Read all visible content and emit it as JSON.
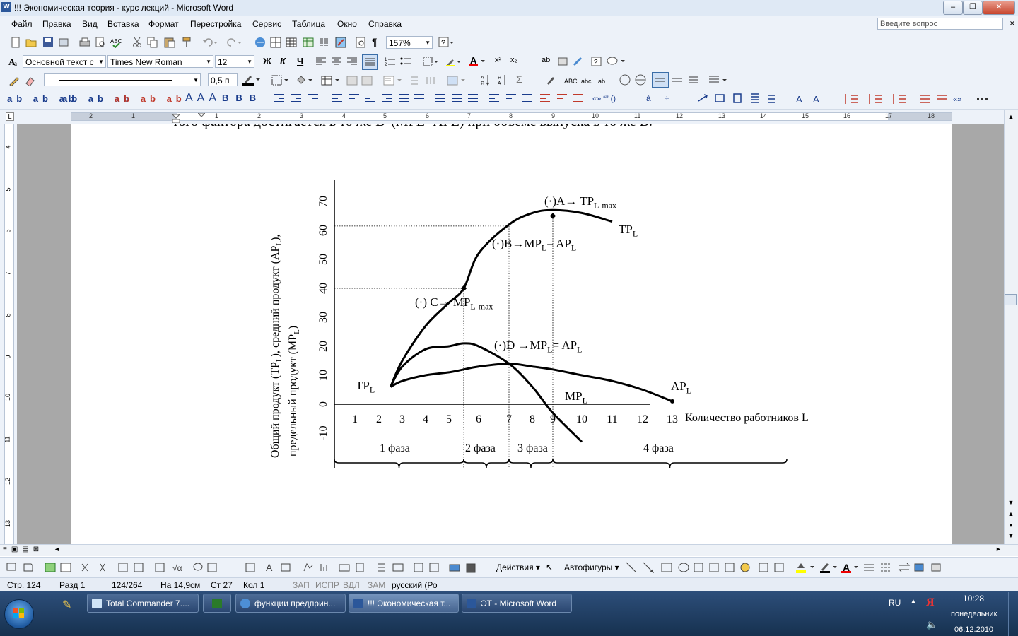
{
  "window": {
    "title": "!!! Экономическая теория - курс лекций - Microsoft Word",
    "app_icon": "W"
  },
  "menu": {
    "items": [
      "Файл",
      "Правка",
      "Вид",
      "Вставка",
      "Формат",
      "Перестройка",
      "Сервис",
      "Таблица",
      "Окно",
      "Справка"
    ],
    "help_placeholder": "Введите вопрос"
  },
  "toolbar": {
    "zoom": "157%",
    "style": "Основной текст с",
    "font": "Times New Roman",
    "size": "12",
    "line_width": "0,5 п"
  },
  "ruler": {
    "numbers": [
      "2",
      "1",
      "1",
      "2",
      "3",
      "4",
      "5",
      "6",
      "7",
      "8",
      "9",
      "10",
      "11",
      "12",
      "13",
      "14",
      "15",
      "16",
      "17",
      "18"
    ]
  },
  "vruler": {
    "numbers": [
      "4",
      "5",
      "6",
      "7",
      "8",
      "9",
      "10",
      "11",
      "12",
      "13"
    ]
  },
  "document": {
    "top_text": "того фактора достигается в то же В' (MPL=APL) при объеме выпуска в то же В."
  },
  "chart_data": {
    "type": "line",
    "ylabel_line1": "Общий продукт (TP",
    "ylabel_sub1": "L",
    "ylabel_mid1": "), средний продукт (AP",
    "ylabel_sub2": "L",
    "ylabel_end1": "),",
    "ylabel_line2": "предельный продукт (MP",
    "ylabel_sub3": "L",
    "ylabel_end2": ")",
    "y_ticks": [
      "70",
      "60",
      "50",
      "40",
      "30",
      "20",
      "10",
      "0",
      "-10"
    ],
    "x_ticks": [
      "1",
      "2",
      "3",
      "4",
      "5",
      "6",
      "7",
      "8",
      "9",
      "10",
      "11",
      "12",
      "13"
    ],
    "xlabel": "Количество работников  L",
    "ylim": [
      -10,
      70
    ],
    "x": [
      2.5,
      3,
      4,
      5,
      5.5,
      6,
      7,
      8,
      9,
      10,
      11,
      12,
      13
    ],
    "series": [
      {
        "name": "TPL",
        "values": [
          6,
          15,
          27,
          35,
          40,
          52,
          62,
          66,
          67,
          66,
          63,
          null,
          null
        ]
      },
      {
        "name": "MPL",
        "values": [
          6,
          13,
          19,
          20,
          21,
          20,
          14,
          6,
          -3,
          -13,
          null,
          null,
          null
        ]
      },
      {
        "name": "APL",
        "values": [
          6,
          8,
          10,
          11,
          12,
          13,
          14,
          13,
          12,
          10,
          8,
          5,
          1
        ]
      }
    ],
    "labels": {
      "tp_curve": "TP",
      "tp_curve_sub": "L",
      "tp_start": "TP",
      "tp_start_sub": "L",
      "mp": "MP",
      "mp_sub": "L",
      "ap": "AP",
      "ap_sub": "L",
      "pointA": "(·)A→ TP",
      "pointA_sub": "L-max",
      "pointB": "(·)B→MP",
      "pointB_sub1": "L",
      "pointB_eq": "= AP",
      "pointB_sub2": "L",
      "pointC": "(·) C→ MP",
      "pointC_sub": "L-max",
      "pointD": "(·)D →MP",
      "pointD_sub1": "L",
      "pointD_eq": "= AP",
      "pointD_sub2": "L"
    },
    "phases": [
      "1 фаза",
      "2 фаза",
      "3 фаза",
      "4 фаза"
    ]
  },
  "status": {
    "page": "Стр. 124",
    "section": "Разд 1",
    "pages": "124/264",
    "position": "На 14,9см",
    "line": "Ст 27",
    "col": "Кол 1",
    "rec": "ЗАП",
    "fix": "ИСПР",
    "ext": "ВДЛ",
    "ovr": "ЗАМ",
    "lang": "русский (Ро"
  },
  "draw": {
    "actions": "Действия",
    "autoshapes": "Автофигуры"
  },
  "taskbar": {
    "tasks": [
      "Total Commander 7....",
      "",
      "функции предприн...",
      "!!! Экономическая т...",
      "ЭТ - Microsoft Word"
    ],
    "lang": "RU",
    "time": "10:28",
    "day": "понедельник",
    "date": "06.12.2010"
  },
  "colors": {
    "titlebar": "#dfe9f5",
    "toolbar": "#edf2f9",
    "taskbar": "#16314f"
  }
}
